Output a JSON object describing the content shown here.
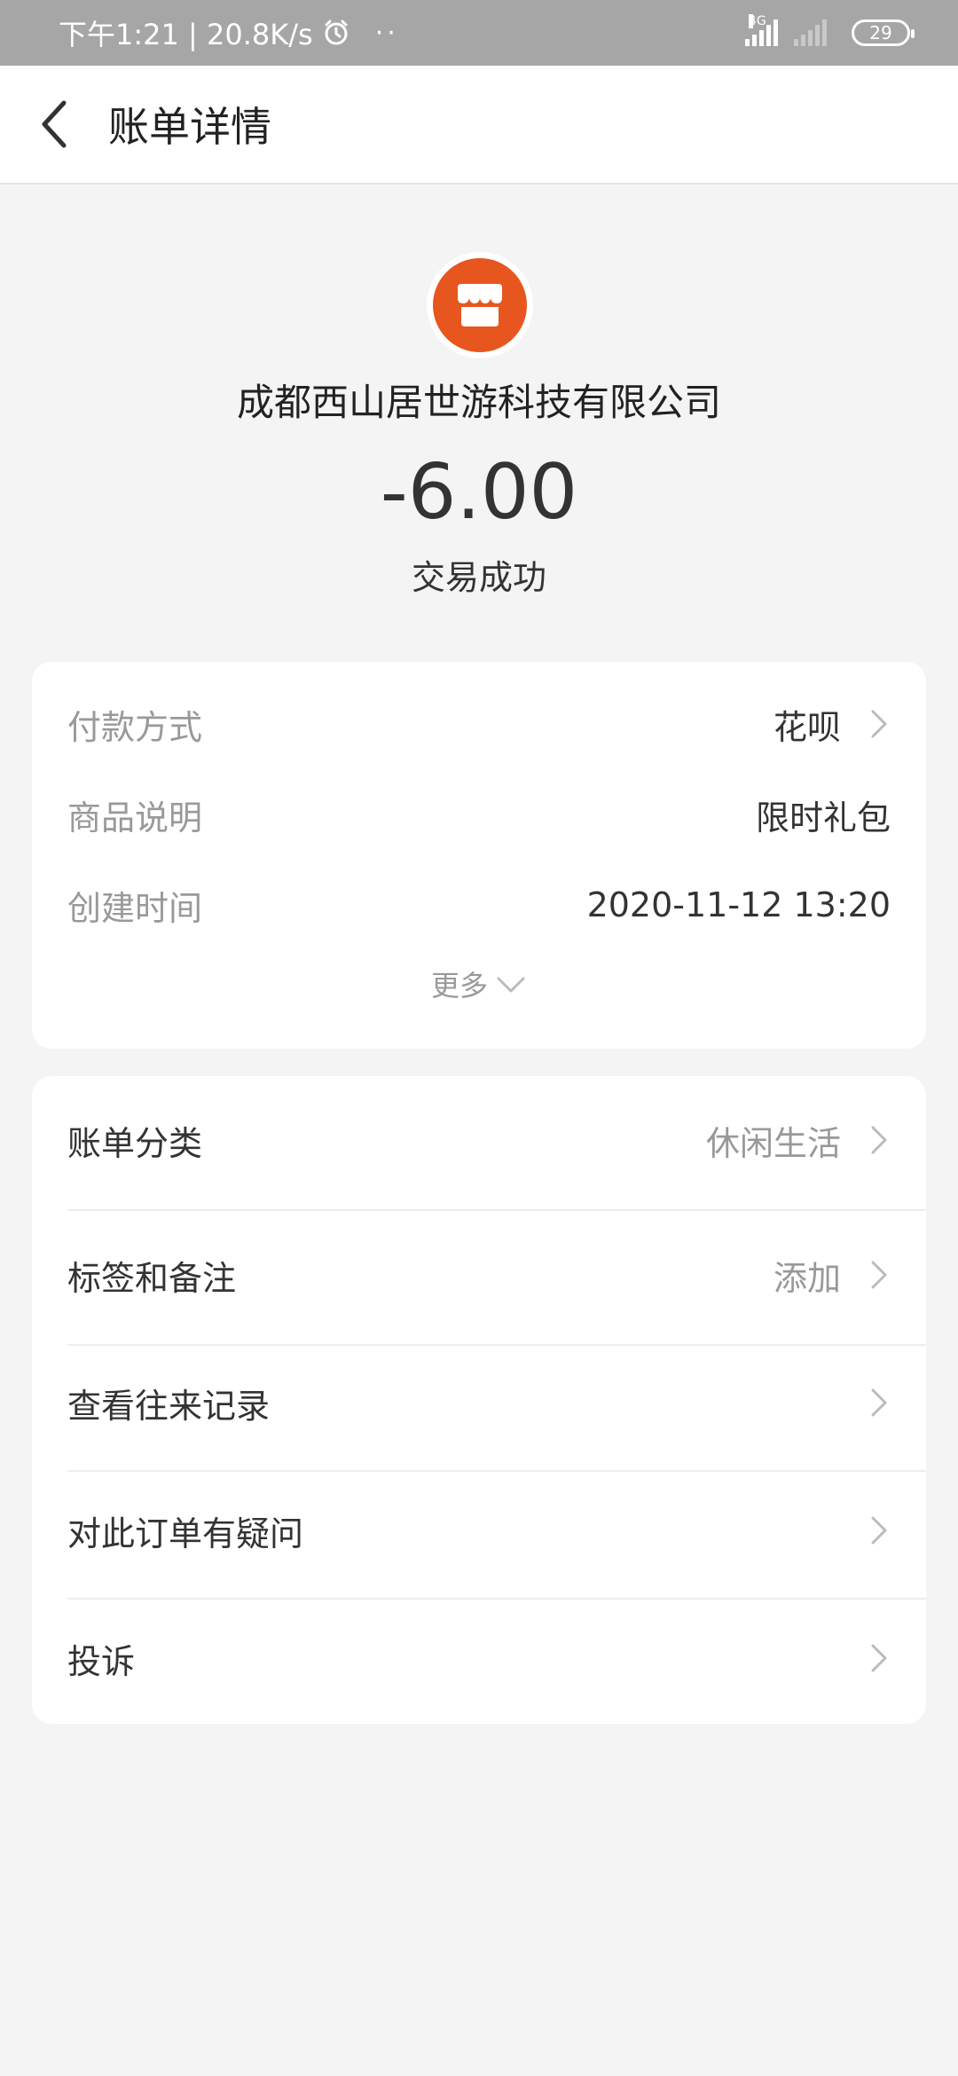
{
  "status_bar": {
    "time_speed": "下午1:21 | 20.8K/s",
    "dots": "··",
    "network": "4G",
    "battery": "29"
  },
  "header": {
    "title": "账单详情"
  },
  "merchant": {
    "name": "成都西山居世游科技有限公司",
    "amount": "-6.00",
    "status": "交易成功",
    "icon_color": "#e7561f"
  },
  "details": {
    "payment_method_label": "付款方式",
    "payment_method_value": "花呗",
    "product_label": "商品说明",
    "product_value": "限时礼包",
    "created_label": "创建时间",
    "created_value": "2020-11-12 13:20",
    "more_label": "更多"
  },
  "menu": {
    "category_label": "账单分类",
    "category_value": "休闲生活",
    "tags_label": "标签和备注",
    "tags_value": "添加",
    "history_label": "查看往来记录",
    "question_label": "对此订单有疑问",
    "complaint_label": "投诉"
  }
}
